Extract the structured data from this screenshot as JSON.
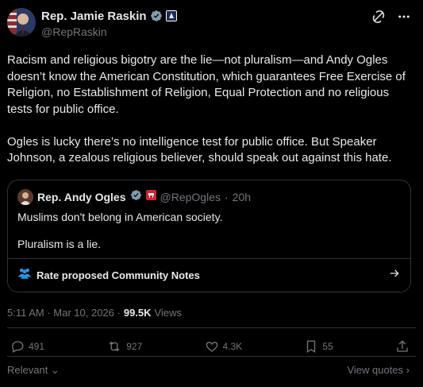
{
  "colors": {
    "background": "#000000",
    "text": "#e7e9ea",
    "muted": "#71767b",
    "border": "#2f3336",
    "verified": "#829aab"
  },
  "author": {
    "name": "Rep. Jamie Raskin",
    "handle": "@RepRaskin",
    "verified_icon": "verified-gray-badge-icon",
    "affiliation_icon": "house-seal-badge-icon"
  },
  "header_icons": [
    "grok-icon",
    "more-icon"
  ],
  "post": {
    "paragraphs": [
      "Racism and religious bigotry are the lie—not pluralism—and Andy Ogles doesn’t know the American Constitution, which guarantees Free Exercise of Religion, no Establishment of Religion, Equal Protection and no religious tests for public office.",
      "Ogles is lucky there’s no intelligence test for public office. But Speaker Johnson, a zealous religious believer, should speak out against this hate."
    ]
  },
  "quote": {
    "name": "Rep. Andy Ogles",
    "handle": "@RepOgles",
    "separator": "·",
    "time": "20h",
    "lines": [
      "Muslims don't belong in American society.",
      "Pluralism is a lie."
    ],
    "notes_label": "Rate proposed Community Notes"
  },
  "meta": {
    "time": "5:11 AM · Mar 10, 2026 ·",
    "views_count": "99.5K",
    "views_label": "Views"
  },
  "actions": {
    "replies": "491",
    "reposts": "927",
    "likes": "4.3K",
    "bookmarks": "55"
  },
  "footer": {
    "sort": "Relevant",
    "view_quotes": "View quotes"
  }
}
